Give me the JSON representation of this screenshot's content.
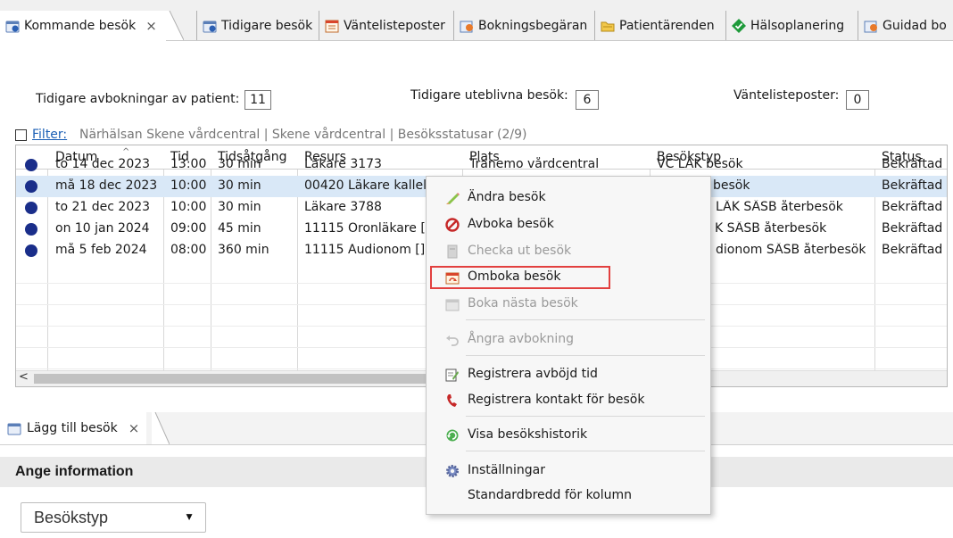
{
  "tabs": [
    {
      "label": "Kommande besök",
      "close": "×",
      "icon": "calendar-icon"
    },
    {
      "label": "Tidigare besök",
      "icon": "calendar-icon"
    },
    {
      "label": "Väntelisteposter",
      "icon": "list-calendar-icon"
    },
    {
      "label": "Bokningsbegäran",
      "icon": "calendar-people-icon"
    },
    {
      "label": "Patientärenden",
      "icon": "folder-icon"
    },
    {
      "label": "Hälsoplanering",
      "icon": "green-diamond-icon"
    },
    {
      "label": "Guidad bo",
      "icon": "calendar-people-icon"
    }
  ],
  "counters": {
    "cancellations": {
      "label": "Tidigare avbokningar av patient:",
      "value": "11"
    },
    "no_shows": {
      "label": "Tidigare uteblivna besök:",
      "value": "6"
    },
    "waitlist": {
      "label": "Väntelisteposter:",
      "value": "0"
    }
  },
  "filter": {
    "link": "Filter:",
    "text": "Närhälsan Skene vårdcentral | Skene vårdcentral | Besöksstatusar (2/9)"
  },
  "grid": {
    "columns": [
      "Datum",
      "Tid",
      "Tidsåtgång",
      "Resurs",
      "Plats",
      "Besökstyp",
      "Status"
    ],
    "sort_indicator": "^",
    "rows": [
      {
        "datum": "to 14 dec 2023",
        "tid": "13:00",
        "tidsatgang": "30 min",
        "resurs": "Läkare 3173",
        "plats": "Tranemo vårdcentral",
        "besokstyp": "VC LÄK besök",
        "status": "Bekräftad"
      },
      {
        "datum": "må 18 dec 2023",
        "tid": "10:00",
        "tidsatgang": "30 min",
        "resurs": "00420 Läkare kallels",
        "plats": "",
        "besokstyp": "besök",
        "status": "Bekräftad"
      },
      {
        "datum": "to 21 dec 2023",
        "tid": "10:00",
        "tidsatgang": "30 min",
        "resurs": "Läkare 3788",
        "plats": "",
        "besokstyp": "LÄK SÄSB återbesök",
        "status": "Bekräftad"
      },
      {
        "datum": "on 10 jan 2024",
        "tid": "09:00",
        "tidsatgang": "45 min",
        "resurs": "11115 Öronläkare []",
        "plats": "",
        "besokstyp": "K SÄSB återbesök",
        "status": "Bekräftad"
      },
      {
        "datum": "må 5 feb 2024",
        "tid": "08:00",
        "tidsatgang": "360 min",
        "resurs": "11115 Audionom []",
        "plats": "",
        "besokstyp": "dionom SÄSB återbesök",
        "status": "Bekräftad"
      }
    ],
    "scroll_left": "<"
  },
  "context_menu": {
    "items": [
      {
        "label": "Ändra besök",
        "icon": "pencil-icon",
        "enabled": true
      },
      {
        "label": "Avboka besök",
        "icon": "cancel-icon",
        "enabled": true
      },
      {
        "label": "Checka ut besök",
        "icon": "checkout-icon",
        "enabled": false
      },
      {
        "label": "Omboka besök",
        "icon": "rebook-icon",
        "enabled": true,
        "highlighted": true
      },
      {
        "label": "Boka nästa besök",
        "icon": "calendar-next-icon",
        "enabled": false
      },
      {
        "label": "Ångra avbokning",
        "icon": "undo-icon",
        "enabled": false
      },
      {
        "label": "Registrera avböjd tid",
        "icon": "note-edit-icon",
        "enabled": true
      },
      {
        "label": "Registrera kontakt för besök",
        "icon": "phone-icon",
        "enabled": true
      },
      {
        "label": "Visa besökshistorik",
        "icon": "history-icon",
        "enabled": true
      },
      {
        "label": "Inställningar",
        "icon": "gear-icon",
        "enabled": true
      },
      {
        "label": "Standardbredd för kolumn",
        "icon": "",
        "enabled": true
      }
    ],
    "highlight_color": "#e2403f"
  },
  "bottom": {
    "tab_label": "Lägg till besök",
    "tab_close": "×",
    "section_title": "Ange information",
    "dropdown_value": "Besökstyp",
    "dropdown_arrow": "▼"
  },
  "colors": {
    "selected_row": "#d9e8f7",
    "status_dot": "#1a2e8a",
    "link": "#1b5fb5"
  }
}
